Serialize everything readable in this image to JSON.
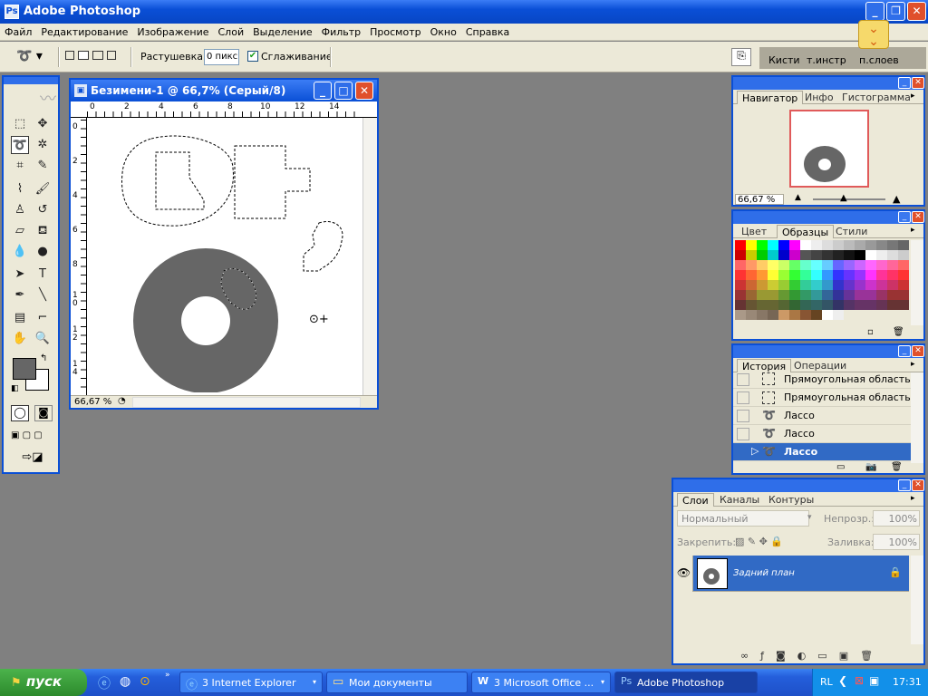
{
  "app": {
    "title": "Adobe Photoshop",
    "window_buttons": [
      "_",
      "❐",
      "✕"
    ]
  },
  "menu": [
    "Файл",
    "Редактирование",
    "Изображение",
    "Слой",
    "Выделение",
    "Фильтр",
    "Просмотр",
    "Окно",
    "Справка"
  ],
  "options": {
    "feather_label": "Растушевка:",
    "feather_value": "0 пикс",
    "antialias_label": "Сглаживание",
    "antialias_checked": true,
    "well_tabs": [
      "Кисти",
      "т.инстр",
      "п.слоев"
    ]
  },
  "document": {
    "title": "Безимени-1 @ 66,7% (Серый/8)",
    "zoom": "66,67 %",
    "ruler_h": [
      "0",
      "2",
      "4",
      "6",
      "8",
      "10",
      "12",
      "14"
    ],
    "ruler_v": [
      "0",
      "2",
      "4",
      "6",
      "8",
      "1\n0",
      "1\n2",
      "1\n4"
    ],
    "shape_color": "#666666"
  },
  "navigator": {
    "tabs": [
      "Навигатор",
      "Инфо",
      "Гистограмма"
    ],
    "zoom": "66,67 %"
  },
  "swatches": {
    "tabs": [
      "Цвет",
      "Образцы",
      "Стили"
    ]
  },
  "history": {
    "tabs": [
      "История",
      "Операции"
    ],
    "items": [
      "Прямоугольная область",
      "Прямоугольная область",
      "Лассо",
      "Лассо",
      "Лассо"
    ],
    "active_index": 4
  },
  "layers": {
    "tabs": [
      "Слои",
      "Каналы",
      "Контуры"
    ],
    "blend_mode": "Нормальный",
    "opacity_label": "Непрозр.:",
    "opacity_value": "100%",
    "lock_label": "Закрепить:",
    "fill_label": "Заливка:",
    "fill_value": "100%",
    "layer_name": "Задний план"
  },
  "taskbar": {
    "start_label": "пуск",
    "buttons": [
      "3 Internet Explorer",
      "Мои документы",
      "3 Microsoft Office ...",
      "Adobe Photoshop"
    ],
    "active_index": 3,
    "lang": "RL",
    "clock": "17:31"
  },
  "colors": {
    "accent": "#0a4fd6",
    "selected_row": "#316ac5",
    "background": "#808080"
  }
}
